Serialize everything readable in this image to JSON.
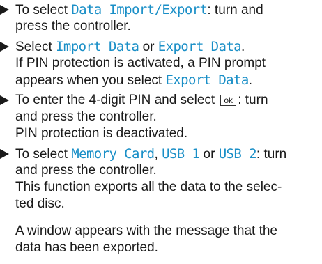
{
  "steps": [
    {
      "lines": [
        {
          "a": "To select ",
          "b": "Data Import/Export",
          "c": ": turn and"
        },
        {
          "a": "press the controller."
        }
      ]
    },
    {
      "lines": [
        {
          "a": "Select ",
          "b": "Import Data",
          "c": " or ",
          "d": "Export Data",
          "e": "."
        },
        {
          "a": "If PIN protection is activated, a PIN prompt"
        },
        {
          "a": "appears when you select ",
          "b": "Export Data",
          "c": "."
        }
      ]
    },
    {
      "lines": [
        {
          "a": "To enter the 4-digit PIN and select",
          "key": "ok",
          "c": ": turn"
        },
        {
          "a": "and press the controller."
        },
        {
          "a": "PIN protection is deactivated."
        }
      ]
    },
    {
      "lines": [
        {
          "a": "To select ",
          "b": "Memory Card",
          "c": ", ",
          "d": "USB 1",
          "e": " or ",
          "f": "USB 2",
          "g": ": turn"
        },
        {
          "a": "and press the controller."
        },
        {
          "a": "This function exports all the data to the selec-"
        },
        {
          "a": "ted disc."
        }
      ]
    }
  ],
  "result": {
    "lines": [
      {
        "a": "A window appears with the message that the"
      },
      {
        "a": "data has been exported."
      }
    ]
  },
  "colors": {
    "highlight": "#1a8fc7",
    "text": "#1a1a1a"
  },
  "icons": {
    "bullet": "right-pointing-triangle-icon"
  }
}
